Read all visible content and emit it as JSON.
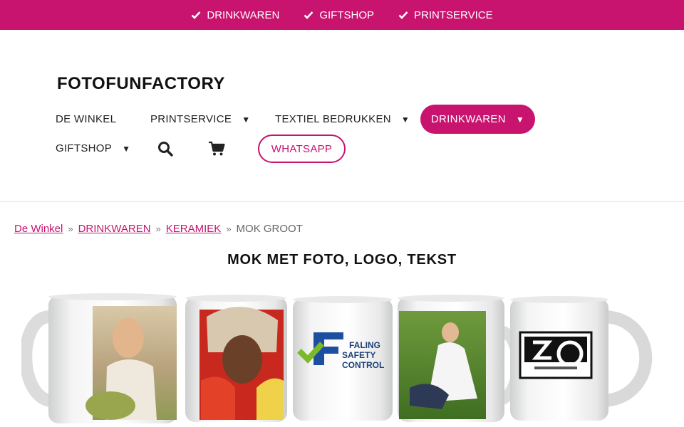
{
  "topbar": {
    "items": [
      {
        "label": "DRINKWAREN",
        "icon": "check-icon"
      },
      {
        "label": "GIFTSHOP",
        "icon": "check-icon"
      },
      {
        "label": "PRINTSERVICE",
        "icon": "check-icon"
      }
    ],
    "color": "#c8136f"
  },
  "brand": "FOTOFUNFACTORY",
  "nav": {
    "de_winkel": "DE WINKEL",
    "printservice": "PRINTSERVICE",
    "textiel": "TEXTIEL BEDRUKKEN",
    "drinkwaren": "DRINKWAREN",
    "giftshop": "GIFTSHOP",
    "whatsapp": "WHATSAPP",
    "caret": "▼",
    "search_icon": "search-icon",
    "cart_icon": "cart-icon"
  },
  "breadcrumb": {
    "items": [
      "De Winkel",
      "DRINKWAREN",
      "KERAMIEK"
    ],
    "current": "MOK GROOT",
    "separator": "»"
  },
  "page_title": "MOK MET FOTO, LOGO, TEKST",
  "mugs": {
    "logo_text_1": "FALING",
    "logo_text_2": "SAFETY",
    "logo_text_3": "CONTROL"
  },
  "accent_color": "#c8136f"
}
